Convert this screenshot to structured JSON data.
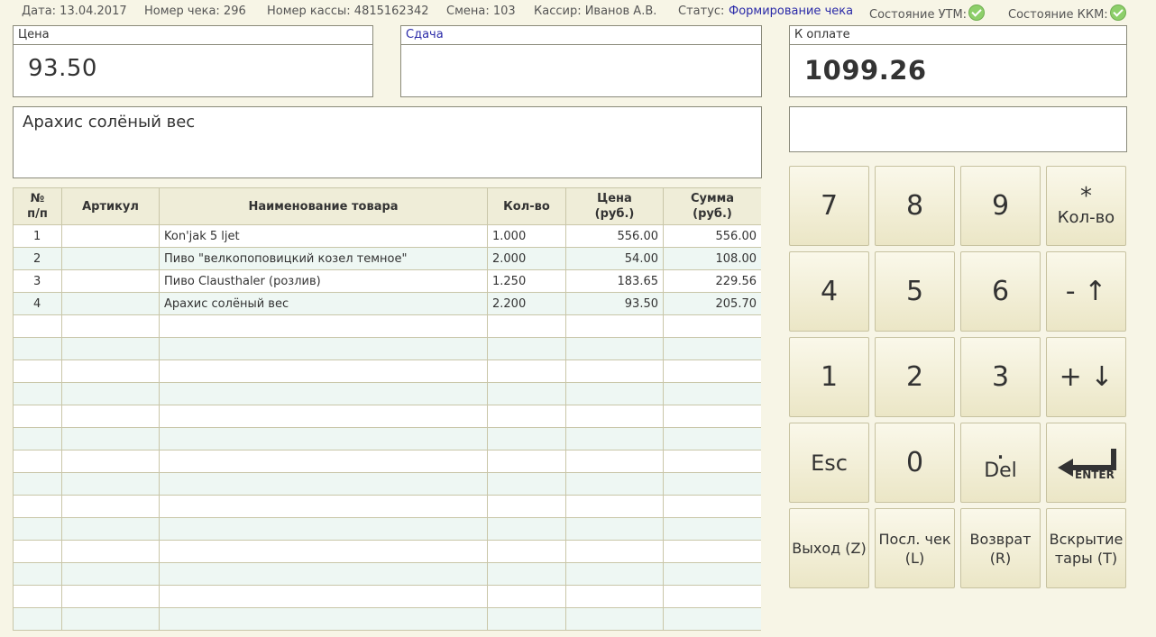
{
  "header": {
    "date": "Дата: 13.04.2017",
    "check_no": "Номер чека: 296",
    "register_no": "Номер кассы: 4815162342",
    "shift": "Смена: 103",
    "cashier": "Кассир: Иванов А.В.",
    "status_label": "Статус:",
    "status_value": "Формирование чека",
    "utm_label": "Состояние УТМ:",
    "kkm_label": "Состояние ККМ:"
  },
  "price": {
    "label": "Цена",
    "value": "93.50"
  },
  "change": {
    "label": "Сдача",
    "value": ""
  },
  "total": {
    "label": "К оплате",
    "value": "1099.26"
  },
  "current_item": "Арахис солёный вес",
  "input_field": {
    "value": ""
  },
  "table": {
    "headers": [
      "№ п/п",
      "Артикул",
      "Наименование товара",
      "Кол-во",
      "Цена (руб.)",
      "Сумма (руб.)"
    ],
    "rows": [
      {
        "num": "1",
        "article": "",
        "name": "Kon'jak 5 ljet",
        "qty": "1.000",
        "price": "556.00",
        "sum": "556.00"
      },
      {
        "num": "2",
        "article": "",
        "name": "Пиво \"велкопоповицкий козел темное\"",
        "qty": "2.000",
        "price": "54.00",
        "sum": "108.00"
      },
      {
        "num": "3",
        "article": "",
        "name": "Пиво Clausthaler (розлив)",
        "qty": "1.250",
        "price": "183.65",
        "sum": "229.56"
      },
      {
        "num": "4",
        "article": "",
        "name": "Арахис солёный вес",
        "qty": "2.200",
        "price": "93.50",
        "sum": "205.70"
      }
    ]
  },
  "keypad": {
    "k7": "7",
    "k8": "8",
    "k9": "9",
    "qty_symbol": "*",
    "qty_label": "Кол-во",
    "k4": "4",
    "k5": "5",
    "k6": "6",
    "minus_label": "- ↑",
    "k1": "1",
    "k2": "2",
    "k3": "3",
    "plus_label": "+ ↓",
    "esc": "Esc",
    "k0": "0",
    "dot": ".",
    "del": "Del",
    "enter_label": "ENTER",
    "exit": "Выход (Z)",
    "last_check": "Посл. чек (L)",
    "return": "Возврат (R)",
    "tare": "Вскрытие тары (T)"
  },
  "colors": {
    "background": "#f7f5e6",
    "status_value": "#2a2aa8",
    "ok_icon": "#8dcf6a"
  }
}
